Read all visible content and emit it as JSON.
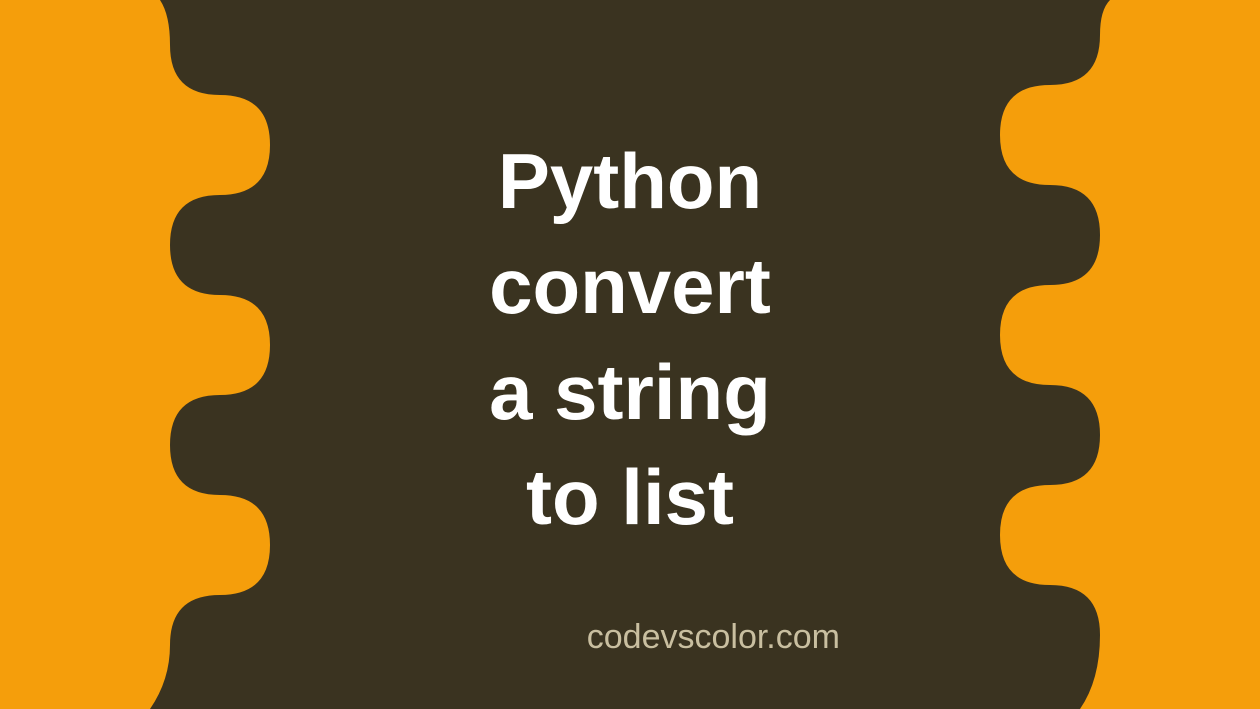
{
  "title": {
    "line1": "Python",
    "line2": "convert",
    "line3": "a string",
    "line4": "to list"
  },
  "credit": "codevscolor.com",
  "colors": {
    "background": "#f59e0b",
    "blob": "#3a3320",
    "titleText": "#ffffff",
    "creditText": "#c9bfa0"
  }
}
